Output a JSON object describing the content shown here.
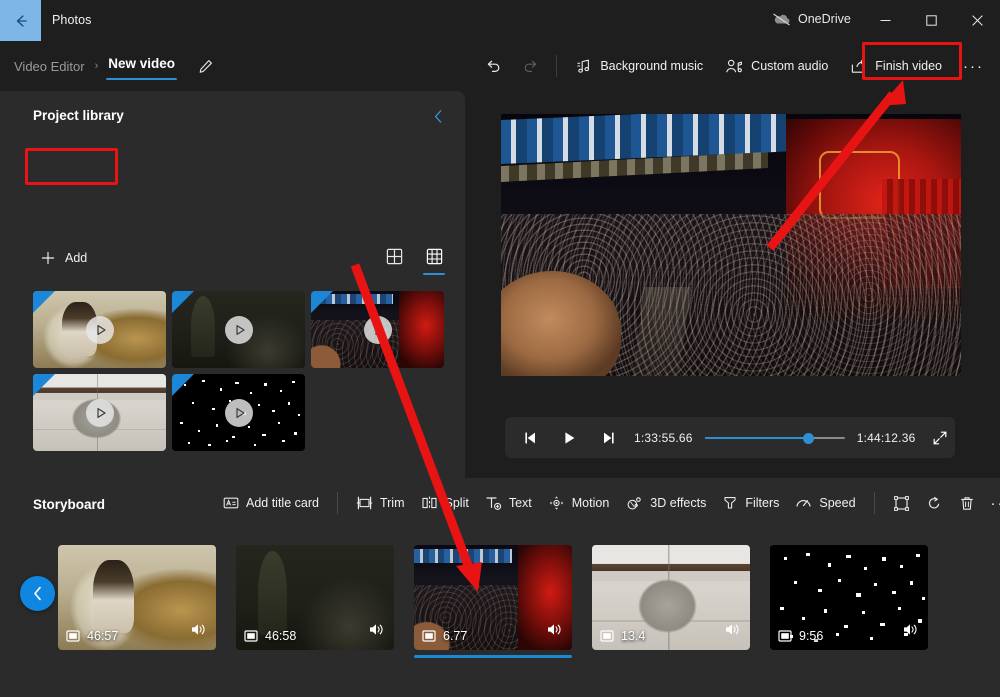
{
  "titlebar": {
    "back_icon": "back-arrow-icon",
    "app_name": "Photos",
    "onedrive_label": "OneDrive",
    "onedrive_icon": "onedrive-cloud-icon",
    "minimize_icon": "minimize-icon",
    "maximize_icon": "maximize-icon",
    "close_icon": "close-icon"
  },
  "breadcrumb": {
    "parent": "Video Editor",
    "separator": "›",
    "current": "New video",
    "edit_icon": "pencil-icon"
  },
  "commandbar": {
    "undo_label": "Undo",
    "redo_label": "Redo",
    "background_music": "Background music",
    "custom_audio": "Custom audio",
    "finish_video": "Finish video",
    "more_label": "See more",
    "more_glyph": "···"
  },
  "library": {
    "title": "Project library",
    "collapse_icon": "chevron-left-icon",
    "add_label": "Add",
    "add_icon": "plus-icon",
    "view_large_icon": "grid-large-icon",
    "view_small_icon": "grid-small-icon",
    "view_active": "grid-small-icon",
    "items": [
      {
        "name": "painting-clip",
        "art": "art-painting",
        "selected": false
      },
      {
        "name": "dark-landscape-clip",
        "art": "art-dark",
        "selected": false
      },
      {
        "name": "concert-clip",
        "art": "art-concert",
        "selected": true
      },
      {
        "name": "dog-clip",
        "art": "art-dog",
        "selected": false
      },
      {
        "name": "night-stars-clip",
        "art": "art-stars",
        "selected": false
      }
    ]
  },
  "player": {
    "prev_frame_icon": "previous-frame-icon",
    "play_icon": "play-icon",
    "next_frame_icon": "next-frame-icon",
    "current_time": "1:33:55.66",
    "total_time": "1:44:12.36",
    "progress_percent": 74,
    "fullscreen_icon": "fullscreen-icon"
  },
  "storyboard": {
    "title": "Storyboard",
    "tools": [
      {
        "name": "add-title-card-button",
        "label": "Add title card",
        "icon": "title-card-icon"
      },
      {
        "name": "trim-button",
        "label": "Trim",
        "icon": "trim-icon"
      },
      {
        "name": "split-button",
        "label": "Split",
        "icon": "split-icon"
      },
      {
        "name": "text-button",
        "label": "Text",
        "icon": "text-icon"
      },
      {
        "name": "motion-button",
        "label": "Motion",
        "icon": "motion-icon"
      },
      {
        "name": "3d-effects-button",
        "label": "3D effects",
        "icon": "3d-effects-icon"
      },
      {
        "name": "filters-button",
        "label": "Filters",
        "icon": "filters-icon"
      },
      {
        "name": "speed-button",
        "label": "Speed",
        "icon": "speed-icon"
      }
    ],
    "right_tools": [
      {
        "name": "aspect-ratio-button",
        "icon": "crop-frame-icon"
      },
      {
        "name": "rotate-button",
        "icon": "rotate-icon"
      },
      {
        "name": "delete-button",
        "icon": "trash-icon"
      },
      {
        "name": "more-options-button",
        "icon": "ellipsis-icon",
        "glyph": "···"
      }
    ],
    "scroll_left_icon": "chevron-left-icon",
    "clips": [
      {
        "name": "clip-painting",
        "duration": "46:57",
        "art": "art-painting",
        "selected": false,
        "volume_icon": "volume-icon"
      },
      {
        "name": "clip-dark-landscape",
        "duration": "46:58",
        "art": "art-dark",
        "selected": false,
        "volume_icon": "volume-icon"
      },
      {
        "name": "clip-concert",
        "duration": "6.77",
        "art": "art-concert",
        "selected": true,
        "volume_icon": "volume-icon"
      },
      {
        "name": "clip-dog",
        "duration": "13.4",
        "art": "art-dog",
        "selected": false,
        "volume_icon": "volume-icon"
      },
      {
        "name": "clip-night-stars",
        "duration": "9:56",
        "art": "art-stars",
        "selected": false,
        "volume_icon": "volume-icon"
      }
    ]
  },
  "annotations": {
    "highlight_color": "#e81313",
    "arrow_to_finish_video": "red-arrow-pointing-to-finish-video",
    "arrow_to_concert_clip": "red-arrow-pointing-to-concert-clip"
  },
  "colors": {
    "accent": "#2d8fd4",
    "panel_bg": "#2b2b2b",
    "app_bg": "#1e1e1e",
    "annotation_red": "#e81313",
    "back_button_bg": "#7cb7e8"
  }
}
